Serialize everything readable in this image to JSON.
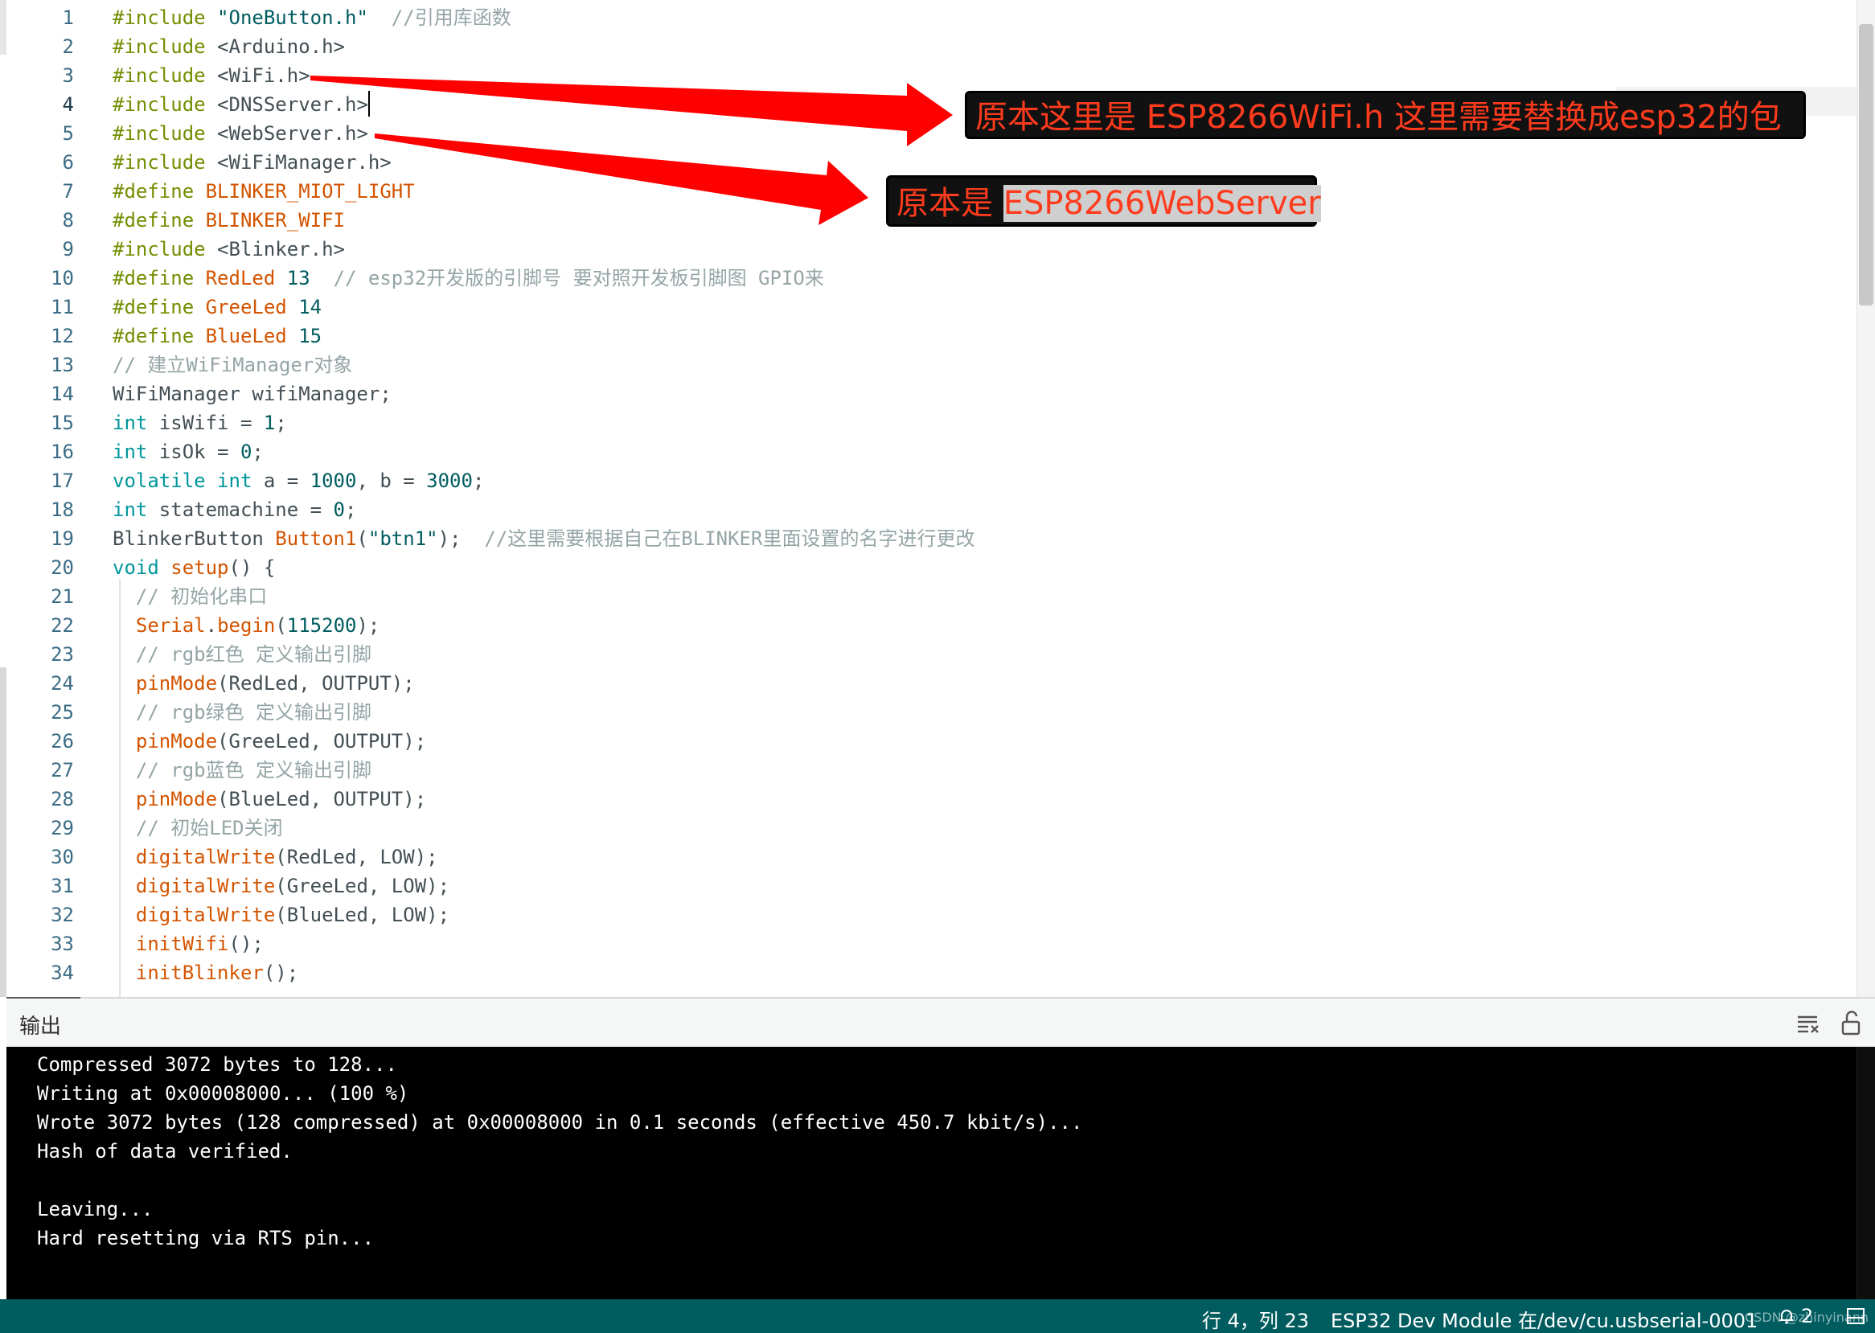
{
  "editor": {
    "lines": [
      {
        "n": "1",
        "t": [
          [
            "kw",
            "#include "
          ],
          [
            "str",
            "\"OneButton.h\""
          ],
          [
            "pl",
            "  "
          ],
          [
            "cm",
            "//引用库函数"
          ]
        ]
      },
      {
        "n": "2",
        "t": [
          [
            "kw",
            "#include "
          ],
          [
            "pl",
            "<Arduino.h>"
          ]
        ]
      },
      {
        "n": "3",
        "t": [
          [
            "kw",
            "#include "
          ],
          [
            "pl",
            "<WiFi.h>"
          ]
        ]
      },
      {
        "n": "4",
        "t": [
          [
            "kw",
            "#include "
          ],
          [
            "pl",
            "<DNSServer.h>"
          ]
        ]
      },
      {
        "n": "5",
        "t": [
          [
            "kw",
            "#include "
          ],
          [
            "pl",
            "<WebServer.h>"
          ]
        ]
      },
      {
        "n": "6",
        "t": [
          [
            "kw",
            "#include "
          ],
          [
            "pl",
            "<WiFiManager.h>"
          ]
        ]
      },
      {
        "n": "7",
        "t": [
          [
            "kw",
            "#define "
          ],
          [
            "const",
            "BLINKER_MIOT_LIGHT"
          ]
        ]
      },
      {
        "n": "8",
        "t": [
          [
            "kw",
            "#define "
          ],
          [
            "const",
            "BLINKER_WIFI"
          ]
        ]
      },
      {
        "n": "9",
        "t": [
          [
            "kw",
            "#include "
          ],
          [
            "pl",
            "<Blinker.h>"
          ]
        ]
      },
      {
        "n": "10",
        "t": [
          [
            "kw",
            "#define "
          ],
          [
            "const",
            "RedLed"
          ],
          [
            "pl",
            " "
          ],
          [
            "num",
            "13"
          ],
          [
            "pl",
            "  "
          ],
          [
            "cm",
            "// esp32开发版的引脚号 要对照开发板引脚图 GPIO来"
          ]
        ]
      },
      {
        "n": "11",
        "t": [
          [
            "kw",
            "#define "
          ],
          [
            "const",
            "GreeLed"
          ],
          [
            "pl",
            " "
          ],
          [
            "num",
            "14"
          ]
        ]
      },
      {
        "n": "12",
        "t": [
          [
            "kw",
            "#define "
          ],
          [
            "const",
            "BlueLed"
          ],
          [
            "pl",
            " "
          ],
          [
            "num",
            "15"
          ]
        ]
      },
      {
        "n": "13",
        "t": [
          [
            "cm",
            "// 建立WiFiManager对象"
          ]
        ]
      },
      {
        "n": "14",
        "t": [
          [
            "pl",
            "WiFiManager wifiManager;"
          ]
        ]
      },
      {
        "n": "15",
        "t": [
          [
            "type",
            "int"
          ],
          [
            "pl",
            " isWifi = "
          ],
          [
            "num",
            "1"
          ],
          [
            "pl",
            ";"
          ]
        ]
      },
      {
        "n": "16",
        "t": [
          [
            "type",
            "int"
          ],
          [
            "pl",
            " isOk = "
          ],
          [
            "num",
            "0"
          ],
          [
            "pl",
            ";"
          ]
        ]
      },
      {
        "n": "17",
        "t": [
          [
            "type",
            "volatile"
          ],
          [
            "pl",
            " "
          ],
          [
            "type",
            "int"
          ],
          [
            "pl",
            " a = "
          ],
          [
            "num",
            "1000"
          ],
          [
            "pl",
            ", b = "
          ],
          [
            "num",
            "3000"
          ],
          [
            "pl",
            ";"
          ]
        ]
      },
      {
        "n": "18",
        "t": [
          [
            "type",
            "int"
          ],
          [
            "pl",
            " statemachine = "
          ],
          [
            "num",
            "0"
          ],
          [
            "pl",
            ";"
          ]
        ]
      },
      {
        "n": "19",
        "t": [
          [
            "pl",
            "BlinkerButton "
          ],
          [
            "fn",
            "Button1"
          ],
          [
            "pl",
            "("
          ],
          [
            "str",
            "\"btn1\""
          ],
          [
            "pl",
            ");  "
          ],
          [
            "cm",
            "//这里需要根据自己在BLINKER里面设置的名字进行更改"
          ]
        ]
      },
      {
        "n": "20",
        "t": [
          [
            "type",
            "void"
          ],
          [
            "pl",
            " "
          ],
          [
            "fn",
            "setup"
          ],
          [
            "pl",
            "() {"
          ]
        ]
      },
      {
        "n": "21",
        "t": [
          [
            "pl",
            "  "
          ],
          [
            "cm",
            "// 初始化串口"
          ]
        ]
      },
      {
        "n": "22",
        "t": [
          [
            "pl",
            "  "
          ],
          [
            "fn",
            "Serial"
          ],
          [
            "pl",
            "."
          ],
          [
            "fn",
            "begin"
          ],
          [
            "pl",
            "("
          ],
          [
            "num",
            "115200"
          ],
          [
            "pl",
            ");"
          ]
        ]
      },
      {
        "n": "23",
        "t": [
          [
            "pl",
            "  "
          ],
          [
            "cm",
            "// rgb红色 定义输出引脚"
          ]
        ]
      },
      {
        "n": "24",
        "t": [
          [
            "pl",
            "  "
          ],
          [
            "fn",
            "pinMode"
          ],
          [
            "pl",
            "(RedLed, OUTPUT);"
          ]
        ]
      },
      {
        "n": "25",
        "t": [
          [
            "pl",
            "  "
          ],
          [
            "cm",
            "// rgb绿色 定义输出引脚"
          ]
        ]
      },
      {
        "n": "26",
        "t": [
          [
            "pl",
            "  "
          ],
          [
            "fn",
            "pinMode"
          ],
          [
            "pl",
            "(GreeLed, OUTPUT);"
          ]
        ]
      },
      {
        "n": "27",
        "t": [
          [
            "pl",
            "  "
          ],
          [
            "cm",
            "// rgb蓝色 定义输出引脚"
          ]
        ]
      },
      {
        "n": "28",
        "t": [
          [
            "pl",
            "  "
          ],
          [
            "fn",
            "pinMode"
          ],
          [
            "pl",
            "(BlueLed, OUTPUT);"
          ]
        ]
      },
      {
        "n": "29",
        "t": [
          [
            "pl",
            "  "
          ],
          [
            "cm",
            "// 初始LED关闭"
          ]
        ]
      },
      {
        "n": "30",
        "t": [
          [
            "pl",
            "  "
          ],
          [
            "fn",
            "digitalWrite"
          ],
          [
            "pl",
            "(RedLed, LOW);"
          ]
        ]
      },
      {
        "n": "31",
        "t": [
          [
            "pl",
            "  "
          ],
          [
            "fn",
            "digitalWrite"
          ],
          [
            "pl",
            "(GreeLed, LOW);"
          ]
        ]
      },
      {
        "n": "32",
        "t": [
          [
            "pl",
            "  "
          ],
          [
            "fn",
            "digitalWrite"
          ],
          [
            "pl",
            "(BlueLed, LOW);"
          ]
        ]
      },
      {
        "n": "33",
        "t": [
          [
            "pl",
            "  "
          ],
          [
            "fn",
            "initWifi"
          ],
          [
            "pl",
            "();"
          ]
        ]
      },
      {
        "n": "34",
        "t": [
          [
            "pl",
            "  "
          ],
          [
            "fn",
            "initBlinker"
          ],
          [
            "pl",
            "();"
          ]
        ]
      }
    ],
    "active_line": "4"
  },
  "annotations": {
    "note1": "原本这里是 ESP8266WiFi.h 这里需要替换成esp32的包",
    "note2_prefix": "原本是 ",
    "note2_selected": "ESP8266WebServer"
  },
  "output": {
    "title": "输出",
    "lines": [
      "Compressed 3072 bytes to 128...",
      "Writing at 0x00008000... (100 %)",
      "Wrote 3072 bytes (128 compressed) at 0x00008000 in 0.1 seconds (effective 450.7 kbit/s)...",
      "Hash of data verified.",
      "",
      "Leaving...",
      "Hard resetting via RTS pin..."
    ]
  },
  "statusbar": {
    "position": "行 4，列 23",
    "board": "ESP32 Dev Module 在/dev/cu.usbserial-0001上",
    "notification_count": "2",
    "watermark": "CSDN @zhinyinann"
  },
  "colors": {
    "accent": "#005c5f",
    "annotation_text": "#ff3b1d",
    "arrow": "#ff0000"
  },
  "icons": {
    "clear": "clear-output-icon",
    "lock": "scroll-lock-icon",
    "bell": "bell-icon",
    "panel": "toggle-panel-icon"
  }
}
